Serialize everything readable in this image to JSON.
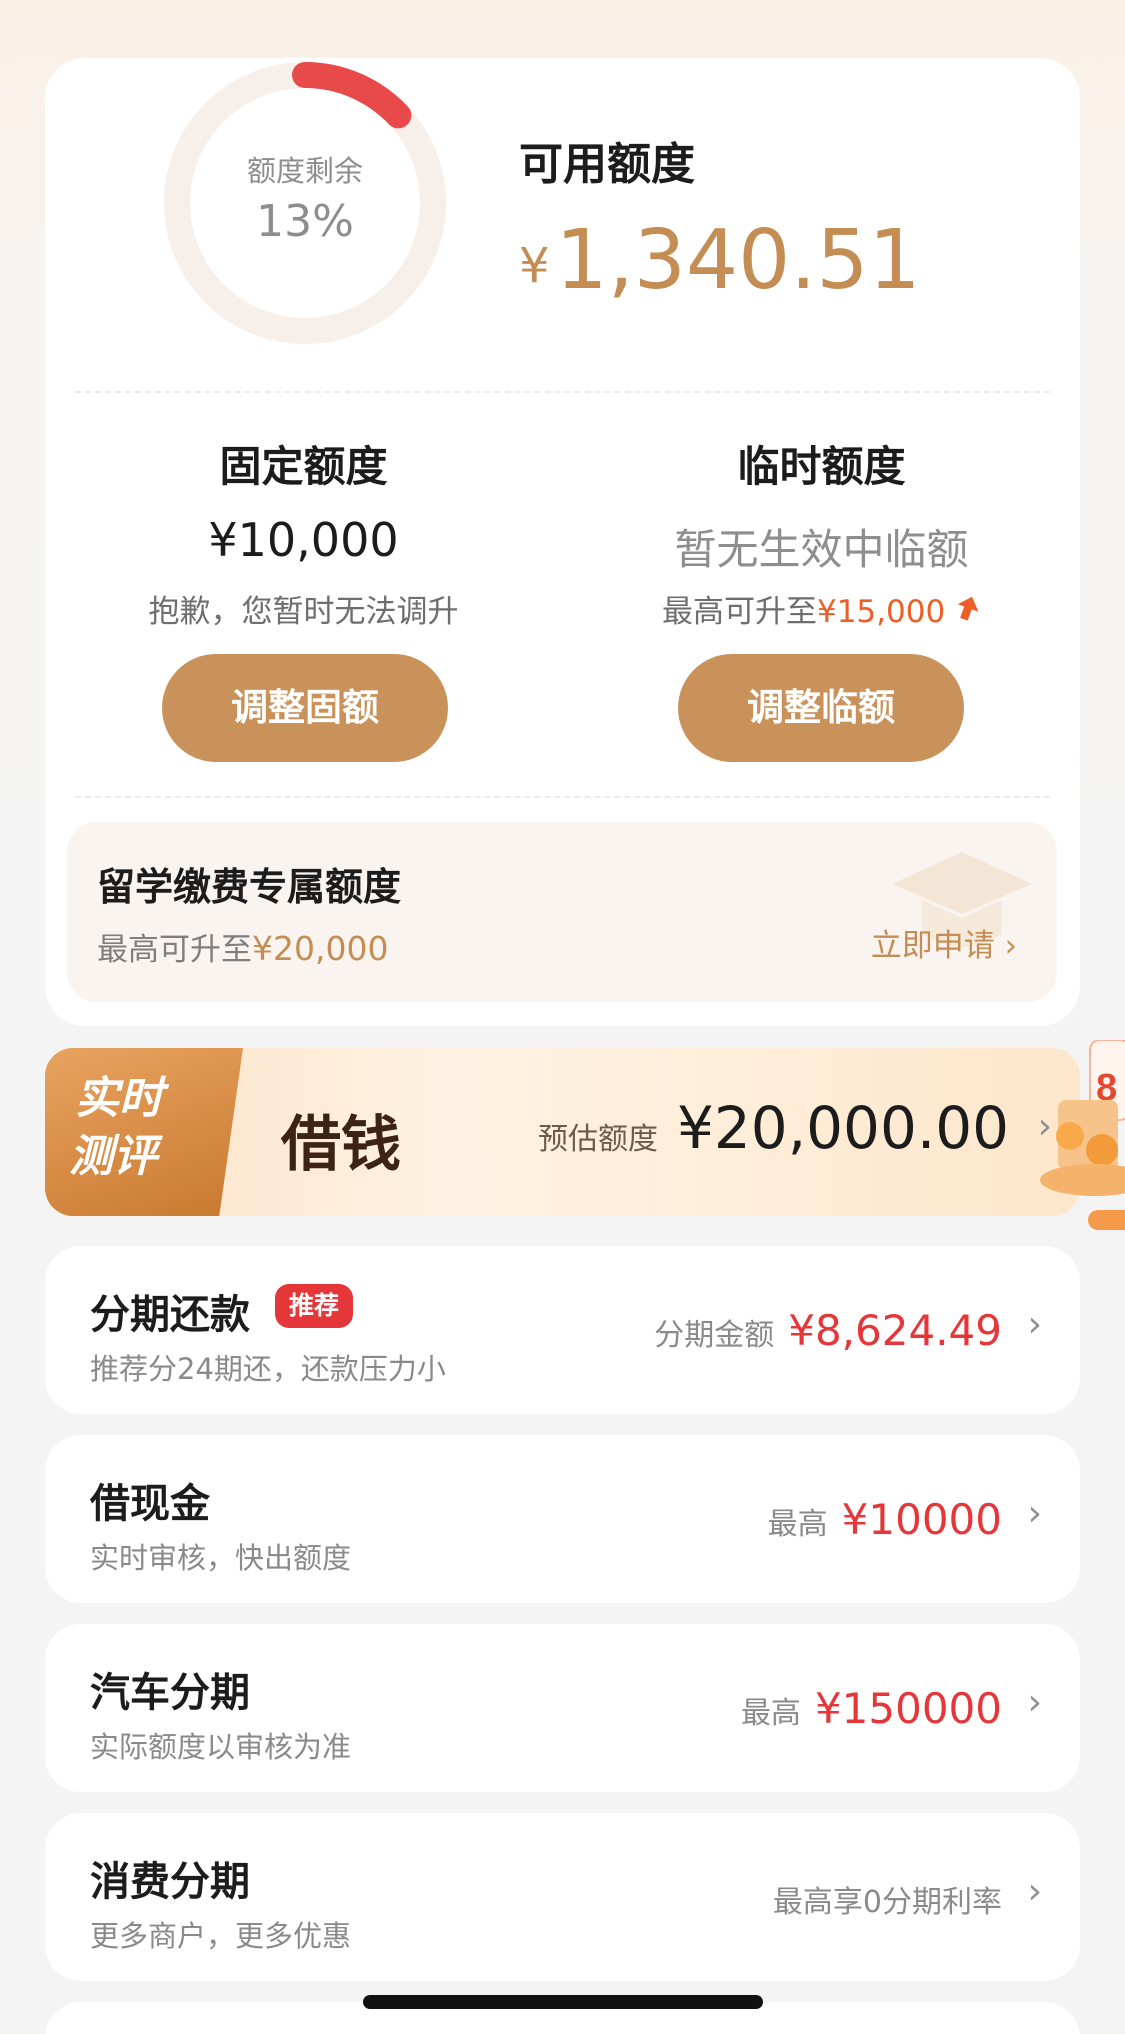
{
  "quota": {
    "ring_title": "额度剩余",
    "ring_percent": "13%",
    "ring_fraction": 0.13,
    "available_title": "可用额度",
    "available_currency": "¥",
    "available_amount": "1,340.51",
    "fixed": {
      "title": "固定额度",
      "value": "¥10,000",
      "note": "抱歉，您暂时无法调升",
      "button": "调整固额"
    },
    "temp": {
      "title": "临时额度",
      "value": "暂无生效中临额",
      "note_prefix": "最高可升至",
      "note_amount": "¥15,000",
      "button": "调整临额"
    },
    "study": {
      "title": "留学缴费专属额度",
      "sub_prefix": "最高可升至",
      "sub_amount": "¥20,000",
      "link": "立即申请 ›"
    }
  },
  "borrow": {
    "tag": [
      "实时",
      "测评"
    ],
    "title": "借钱",
    "est_label": "预估额度",
    "est_amount": "¥20,000.00",
    "badge_partial": "8"
  },
  "rows": [
    {
      "title": "分期还款",
      "badge": "推荐",
      "sub": "推荐分24期还，还款压力小",
      "label": "分期金额",
      "amount": "¥8,624.49"
    },
    {
      "title": "借现金",
      "sub": "实时审核，快出额度",
      "label": "最高",
      "amount": "¥10000"
    },
    {
      "title": "汽车分期",
      "sub": "实际额度以审核为准",
      "label": "最高",
      "amount": "¥150000"
    },
    {
      "title": "消费分期",
      "sub": "更多商户，更多优惠",
      "plain": "最高享0分期利率"
    }
  ],
  "icons": {
    "chevron": "chevron-right-icon",
    "graduation": "graduation-cap-icon",
    "up_arrow": "up-arrow-icon"
  },
  "colors": {
    "gold": "#c38d53",
    "button": "#c8925a",
    "red": "#e5363a",
    "ring_arc": "#e84a4a",
    "orange": "#ee5f28"
  }
}
